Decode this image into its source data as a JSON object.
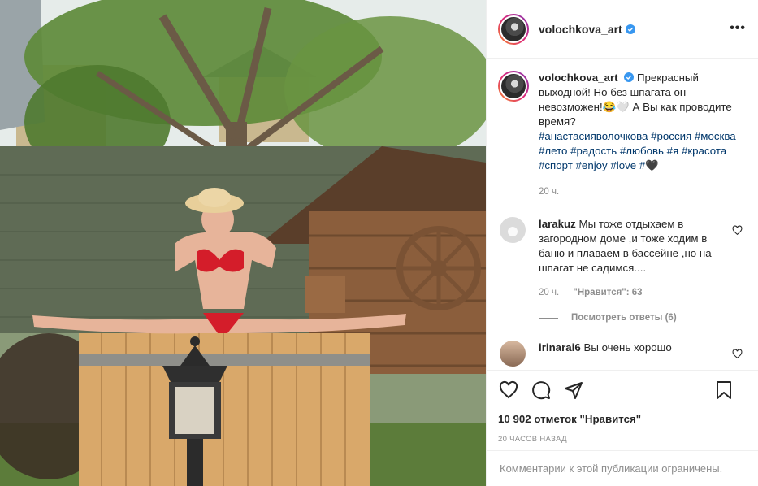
{
  "post": {
    "username": "volochkova_art",
    "more_icon": "more-horizontal-icon",
    "caption": {
      "text": "Прекрасный выходной! Но без шпагата он невозможен!😂🤍 А Вы как проводите время?",
      "hashtags": "#анастасияволочкова #россия #москва #лето #радость #любовь #я #красота #спорт #enjoy #love #🖤",
      "time": "20 ч."
    },
    "comments": [
      {
        "username": "larakuz",
        "text": "Мы тоже отдыхаем в загородном доме ,и тоже ходим в баню и плаваем в бассейне ,но на шпагат не садимся....",
        "time": "20 ч.",
        "likes": "\"Нравится\": 63",
        "replies": "Посмотреть ответы (6)"
      },
      {
        "username": "irinarai6",
        "text": "Вы очень хорошо"
      }
    ],
    "likes_count": "10 902 отметок \"Нравится\"",
    "date": "20 часов назад",
    "comments_disabled": "Комментарии к этой публикации ограничены."
  },
  "icons": [
    "like-heart-icon",
    "comment-icon",
    "share-icon",
    "save-bookmark-icon",
    "verified-badge-icon"
  ],
  "colors": {
    "text": "#262626",
    "muted": "#8e8e8e",
    "link": "#00376b",
    "border": "#efefef",
    "verified": "#3897f0"
  }
}
